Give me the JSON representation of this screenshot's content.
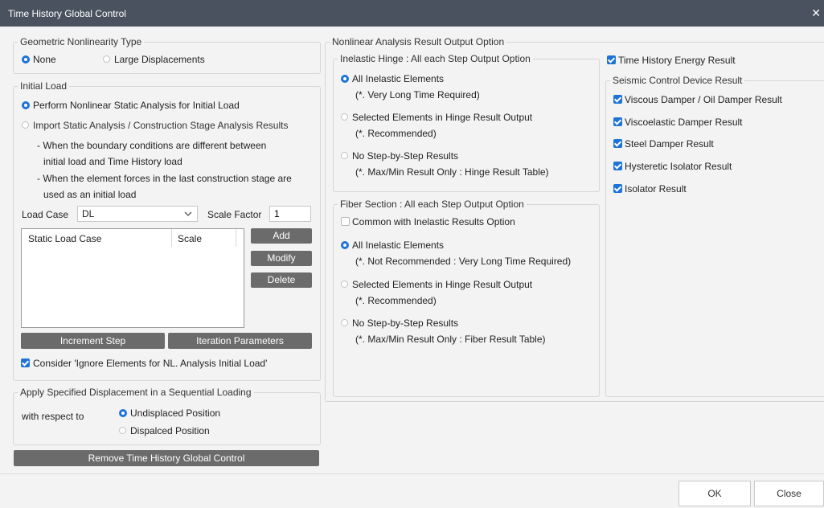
{
  "window": {
    "title": "Time History Global Control",
    "close_glyph": "✕"
  },
  "geometric": {
    "title": "Geometric Nonlinearity Type",
    "options": [
      "None",
      "Large Displacements"
    ],
    "selected": 0
  },
  "initial_load": {
    "title": "Initial Load",
    "opt_perform": "Perform Nonlinear Static Analysis for Initial Load",
    "opt_import": "Import Static Analysis / Construction Stage Analysis Results",
    "notes": [
      "- When the boundary conditions are different between",
      "initial load and Time History load",
      "- When the element forces in the last construction stage are",
      "used as an initial load"
    ],
    "load_case_label": "Load Case",
    "load_case_value": "DL",
    "scale_factor_label": "Scale Factor",
    "scale_factor_value": "1",
    "table_headers": [
      "Static Load Case",
      "Scale"
    ],
    "btn_add": "Add",
    "btn_modify": "Modify",
    "btn_delete": "Delete",
    "btn_increment": "Increment Step",
    "btn_iteration": "Iteration Parameters",
    "consider_label": "Consider 'Ignore Elements for NL. Analysis Initial Load'"
  },
  "displacement": {
    "title": "Apply Specified Displacement in a Sequential Loading",
    "with_respect": "with respect to",
    "opt_undisplaced": "Undisplaced Position",
    "opt_displaced": "Dispalced Position"
  },
  "remove_button": "Remove Time History Global Control",
  "output": {
    "title": "Nonlinear Analysis Result Output Option",
    "inelastic": {
      "title": "Inelastic Hinge : All each Step Output Option",
      "opt1": "All Inelastic Elements",
      "opt1_note": "(*. Very Long Time Required)",
      "opt2": "Selected Elements in Hinge Result Output",
      "opt2_note": "(*. Recommended)",
      "opt3": "No Step-by-Step Results",
      "opt3_note": "(*. Max/Min Result Only : Hinge Result Table)"
    },
    "fiber": {
      "title": "Fiber Section : All each Step Output Option",
      "common": "Common with Inelastic Results Option",
      "opt1": "All Inelastic Elements",
      "opt1_note": "(*. Not Recommended : Very Long Time Required)",
      "opt2": "Selected Elements in Hinge Result Output",
      "opt2_note": "(*. Recommended)",
      "opt3": "No Step-by-Step Results",
      "opt3_note": "(*. Max/Min Result Only : Fiber Result Table)"
    },
    "energy": "Time History Energy Result",
    "seismic": {
      "title": "Seismic Control Device Result",
      "items": [
        "Viscous Damper / Oil Damper Result",
        "Viscoelastic Damper Result",
        "Steel Damper Result",
        "Hysteretic Isolator Result",
        "Isolator Result"
      ]
    }
  },
  "footer": {
    "ok": "OK",
    "close": "Close"
  },
  "colors": {
    "accent": "#1e73d8",
    "titlebar": "#4a5260",
    "button": "#6b6b6b"
  }
}
